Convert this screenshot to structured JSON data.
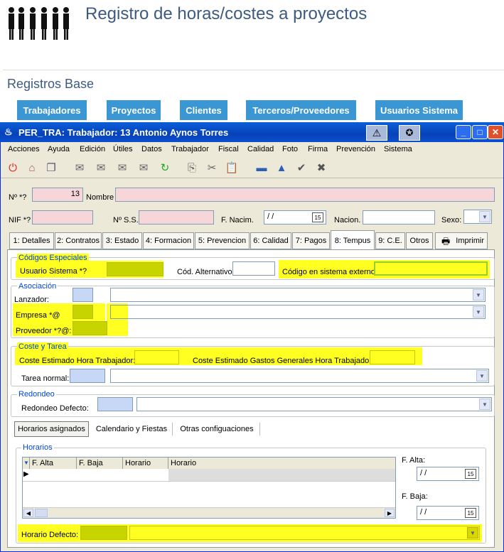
{
  "header": {
    "title": "Registro de horas/costes a proyectos",
    "section": "Registros Base"
  },
  "nav": [
    "Trabajadores",
    "Proyectos",
    "Clientes",
    "Terceros/Proveedores",
    "Usuarios Sistema"
  ],
  "window": {
    "title": "PER_TRA: Trabajador: 13 Antonio Aynos Torres",
    "title_bar_color": "#0a4fd0"
  },
  "menu": [
    "Acciones",
    "Ayuda",
    "Edición",
    "Útiles",
    "Datos",
    "Trabajador",
    "Fiscal",
    "Calidad",
    "Foto",
    "Firma",
    "Prevención",
    "Sistema"
  ],
  "toolbar_icons": [
    "power-icon",
    "home-icon",
    "windows-icon",
    "stamp-icon",
    "stamp-check-icon",
    "stamp-x-icon",
    "stamp-delete-icon",
    "refresh-icon",
    "copy-icon",
    "cut-icon",
    "paste-icon",
    "minus-icon",
    "up-icon",
    "check-icon",
    "close-icon"
  ],
  "form": {
    "num_label": "Nº *?",
    "num_value": "13",
    "nombre_label": "Nombre",
    "nif_label": "NIF *?",
    "nss_label": "Nº S.S.",
    "fnac_label": "F. Nacim.",
    "fnac_value": "/ /",
    "nacion_label": "Nacion.",
    "sexo_label": "Sexo:"
  },
  "tabs": [
    "1: Detalles",
    "2: Contratos",
    "3: Estado",
    "4: Formacion",
    "5: Prevencion",
    "6: Calidad",
    "7: Pagos",
    "8: Tempus",
    "9: C.E.",
    "Otros",
    "Imprimir"
  ],
  "active_tab": "8: Tempus",
  "codigos": {
    "title": "Códigos Especiales",
    "usuario_label": "Usuario Sistema *?",
    "cod_alt_label": "Cód. Alternativo",
    "codigo_ext_label": "Código en sistema externo"
  },
  "asociacion": {
    "title": "Asociación",
    "lanzador_label": "Lanzador:",
    "empresa_label": "Empresa *@",
    "proveedor_label": "Proveedor *?@:"
  },
  "coste": {
    "title": "Coste y Tarea",
    "coste_hora_label": "Coste Estimado Hora Trabajador:",
    "coste_gg_label": "Coste Estimado Gastos Generales Hora Trabajador:",
    "tarea_label": "Tarea normal:"
  },
  "redondeo": {
    "title": "Redondeo",
    "defecto_label": "Redondeo Defecto:"
  },
  "subtabs": [
    "Horarios asignados",
    "Calendario y Fiestas",
    "Otras configuaciones"
  ],
  "horarios": {
    "title": "Horarios",
    "columns": [
      "F. Alta",
      "F. Baja",
      "Horario",
      "Horario"
    ],
    "falta_label": "F. Alta:",
    "falta_value": "/ /",
    "fbaja_label": "F. Baja:",
    "fbaja_value": "/ /",
    "defecto_label": "Horario Defecto:"
  },
  "colors": {
    "nav": "#3b97d3",
    "highlight": "#ffff22",
    "required": "#f6d6d9",
    "olive": "#c8d400"
  }
}
